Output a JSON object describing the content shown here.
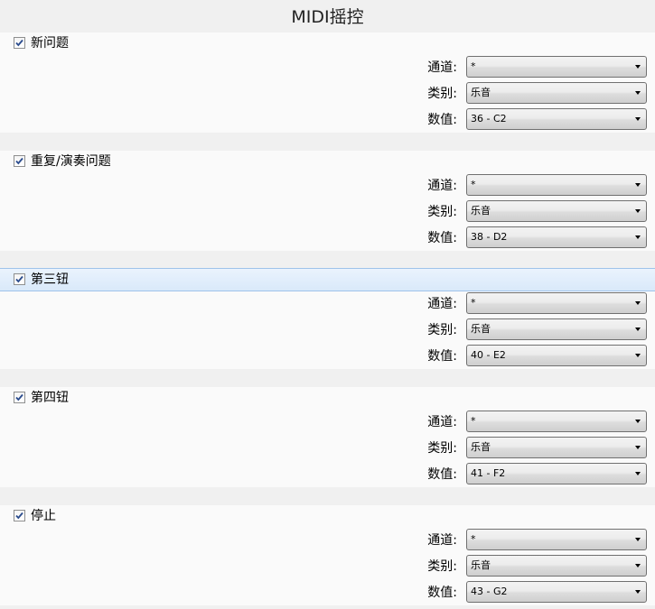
{
  "window": {
    "title": "MIDI摇控"
  },
  "field_labels": {
    "channel": "通道:",
    "category": "类别:",
    "value": "数值:"
  },
  "sections": [
    {
      "title": "新问题",
      "checked": true,
      "channel": "*",
      "category": "乐音",
      "value": "36 - C2"
    },
    {
      "title": "重复/演奏问题",
      "checked": true,
      "channel": "*",
      "category": "乐音",
      "value": "38 - D2"
    },
    {
      "title": "第三钮",
      "checked": true,
      "selected": true,
      "channel": "*",
      "category": "乐音",
      "value": "40 - E2"
    },
    {
      "title": "第四钮",
      "checked": true,
      "channel": "*",
      "category": "乐音",
      "value": "41 - F2"
    },
    {
      "title": "停止",
      "checked": true,
      "channel": "*",
      "category": "乐音",
      "value": "43 - G2"
    }
  ]
}
